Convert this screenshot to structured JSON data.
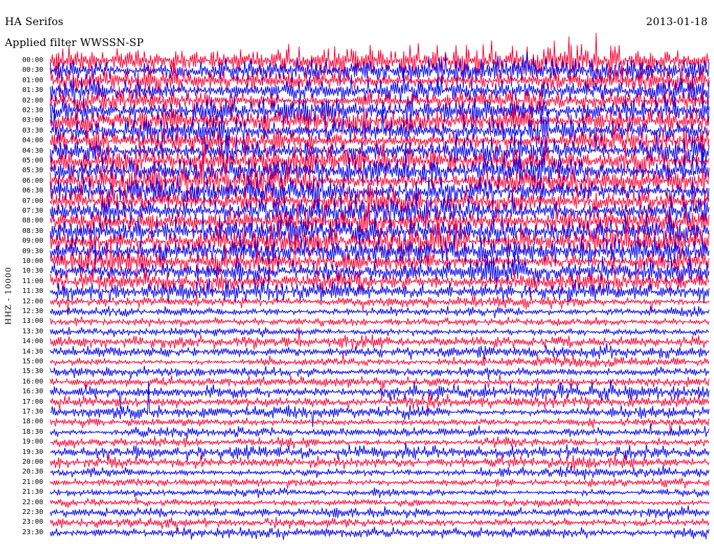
{
  "header": {
    "station": "HA Serifos",
    "date": "2013-01-18",
    "filter": "Applied filter WWSSN-SP"
  },
  "chart_data": {
    "type": "line",
    "ylabel": "HHZ - 10000",
    "row_labels": [
      "00:00",
      "00:30",
      "01:00",
      "01:30",
      "02:00",
      "02:30",
      "03:00",
      "03:30",
      "04:00",
      "04:30",
      "05:00",
      "05:30",
      "06:00",
      "06:30",
      "07:00",
      "07:30",
      "08:00",
      "08:30",
      "09:00",
      "09:30",
      "10:00",
      "10:30",
      "11:00",
      "11:30",
      "12:00",
      "12:30",
      "13:00",
      "13:30",
      "14:00",
      "14:30",
      "15:00",
      "15:30",
      "16:00",
      "16:30",
      "17:00",
      "17:30",
      "18:00",
      "18:30",
      "19:00",
      "19:30",
      "20:00",
      "20:30",
      "21:00",
      "21:30",
      "22:00",
      "22:30",
      "23:00",
      "23:30"
    ],
    "trace_colors": [
      "#ff0033",
      "#0000ee"
    ],
    "background": "#ffffff",
    "grid": false,
    "amplitude_scale": [
      3.2,
      3.1,
      3.1,
      3.0,
      3.0,
      2.9,
      2.9,
      3.0,
      3.0,
      2.9,
      2.9,
      3.1,
      3.2,
      3.1,
      3.0,
      3.0,
      3.0,
      2.9,
      2.9,
      2.9,
      2.9,
      2.8,
      2.6,
      2.1,
      1.15,
      1.0,
      1.05,
      1.0,
      1.5,
      1.4,
      1.0,
      1.0,
      1.1,
      1.4,
      1.5,
      1.4,
      1.0,
      1.0,
      1.2,
      1.4,
      1.3,
      1.1,
      0.85,
      0.9,
      1.0,
      1.0,
      1.1,
      1.2
    ]
  }
}
